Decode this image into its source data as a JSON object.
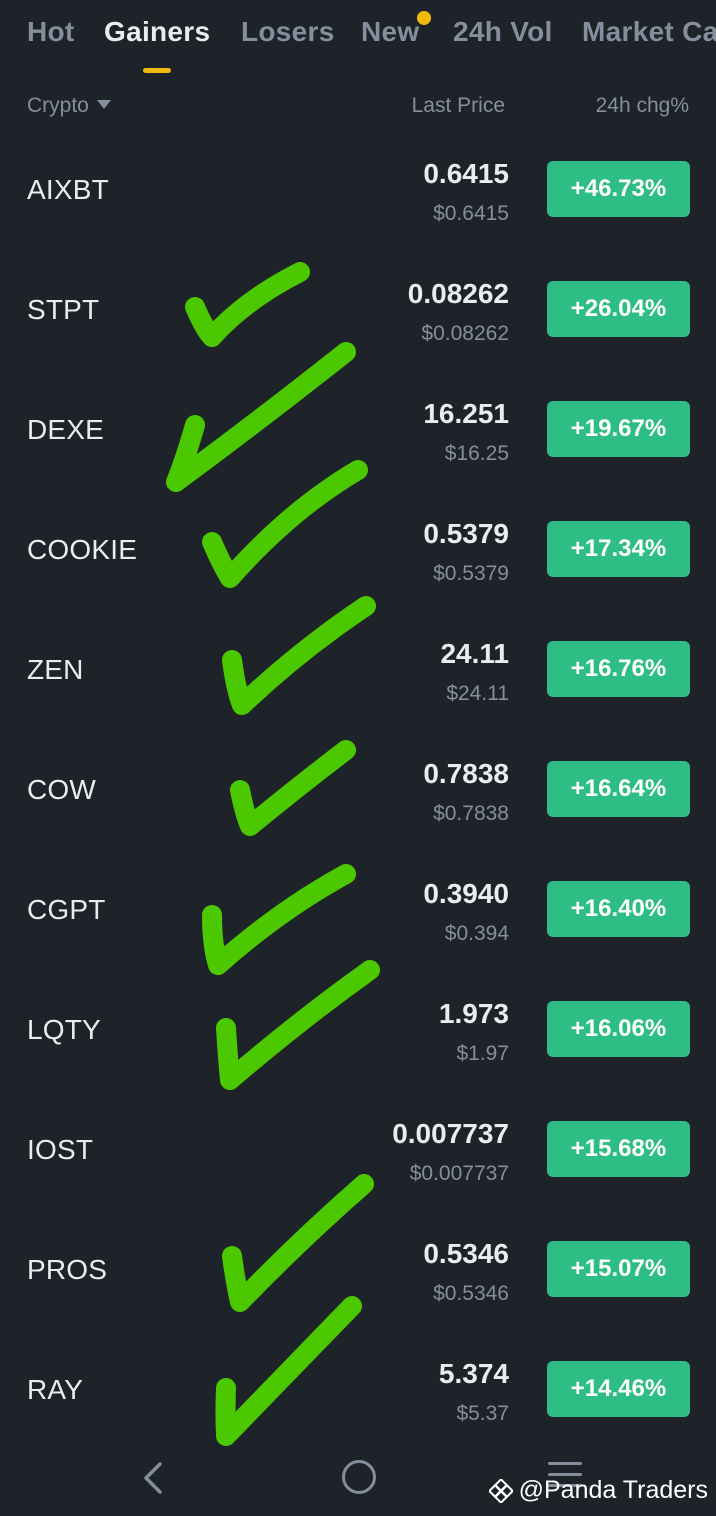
{
  "tabs": [
    {
      "label": "Hot"
    },
    {
      "label": "Gainers"
    },
    {
      "label": "Losers"
    },
    {
      "label": "New"
    },
    {
      "label": "24h Vol"
    },
    {
      "label": "Market Ca"
    }
  ],
  "header": {
    "crypto": "Crypto",
    "last_price": "Last Price",
    "change": "24h chg%"
  },
  "rows": [
    {
      "symbol": "AIXBT",
      "price": "0.6415",
      "fiat": "$0.6415",
      "change": "+46.73%"
    },
    {
      "symbol": "STPT",
      "price": "0.08262",
      "fiat": "$0.08262",
      "change": "+26.04%"
    },
    {
      "symbol": "DEXE",
      "price": "16.251",
      "fiat": "$16.25",
      "change": "+19.67%"
    },
    {
      "symbol": "COOKIE",
      "price": "0.5379",
      "fiat": "$0.5379",
      "change": "+17.34%"
    },
    {
      "symbol": "ZEN",
      "price": "24.11",
      "fiat": "$24.11",
      "change": "+16.76%"
    },
    {
      "symbol": "COW",
      "price": "0.7838",
      "fiat": "$0.7838",
      "change": "+16.64%"
    },
    {
      "symbol": "CGPT",
      "price": "0.3940",
      "fiat": "$0.394",
      "change": "+16.40%"
    },
    {
      "symbol": "LQTY",
      "price": "1.973",
      "fiat": "$1.97",
      "change": "+16.06%"
    },
    {
      "symbol": "IOST",
      "price": "0.007737",
      "fiat": "$0.007737",
      "change": "+15.68%"
    },
    {
      "symbol": "PROS",
      "price": "0.5346",
      "fiat": "$0.5346",
      "change": "+15.07%"
    },
    {
      "symbol": "RAY",
      "price": "5.374",
      "fiat": "$5.37",
      "change": "+14.46%"
    }
  ],
  "watermark": {
    "text": "@Panda Traders"
  },
  "colors": {
    "background": "#1e2329",
    "accent": "#f0b90b",
    "gain": "#2ebd85",
    "check": "#4cc800"
  }
}
